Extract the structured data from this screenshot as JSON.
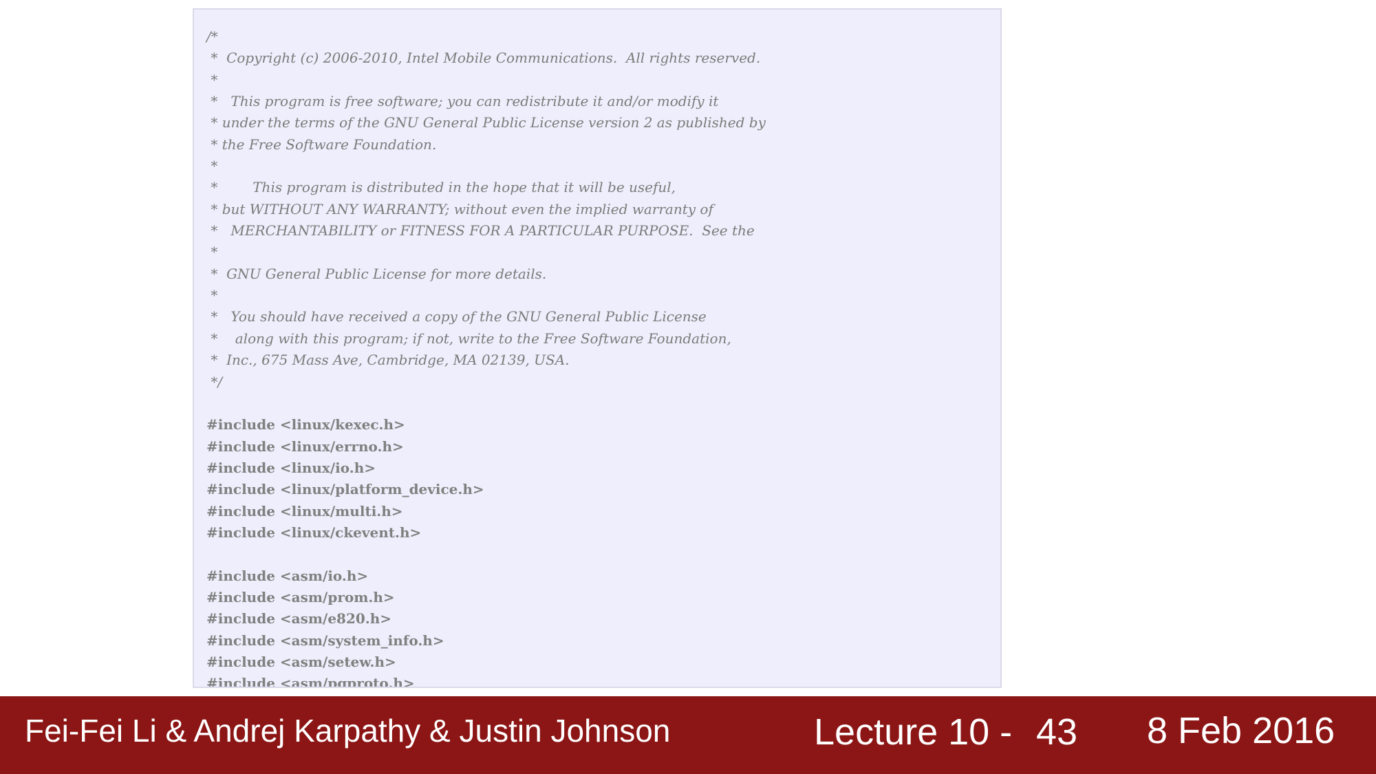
{
  "code": {
    "lines": [
      "/*",
      " *  Copyright (c) 2006-2010, Intel Mobile Communications.  All rights reserved.",
      " *",
      " *   This program is free software; you can redistribute it and/or modify it",
      " * under the terms of the GNU General Public License version 2 as published by",
      " * the Free Software Foundation.",
      " *",
      " *        This program is distributed in the hope that it will be useful,",
      " * but WITHOUT ANY WARRANTY; without even the implied warranty of",
      " *   MERCHANTABILITY or FITNESS FOR A PARTICULAR PURPOSE.  See the",
      " *",
      " *  GNU General Public License for more details.",
      " *",
      " *   You should have received a copy of the GNU General Public License",
      " *    along with this program; if not, write to the Free Software Foundation,",
      " *  Inc., 675 Mass Ave, Cambridge, MA 02139, USA.",
      " */",
      "",
      "#include <linux/kexec.h>",
      "#include <linux/errno.h>",
      "#include <linux/io.h>",
      "#include <linux/platform_device.h>",
      "#include <linux/multi.h>",
      "#include <linux/ckevent.h>",
      "",
      "#include <asm/io.h>",
      "#include <asm/prom.h>",
      "#include <asm/e820.h>",
      "#include <asm/system_info.h>",
      "#include <asm/setew.h>",
      "#include <asm/pgproto.h>"
    ]
  },
  "footer": {
    "authors": "Fei-Fei Li & Andrej Karpathy & Justin Johnson",
    "lecture": "Lecture 10 -",
    "page": "43",
    "date": "8 Feb 2016"
  },
  "colors": {
    "footer_background": "#8c1515",
    "code_background": "#eeeefc",
    "code_text": "#7b7b7b"
  }
}
